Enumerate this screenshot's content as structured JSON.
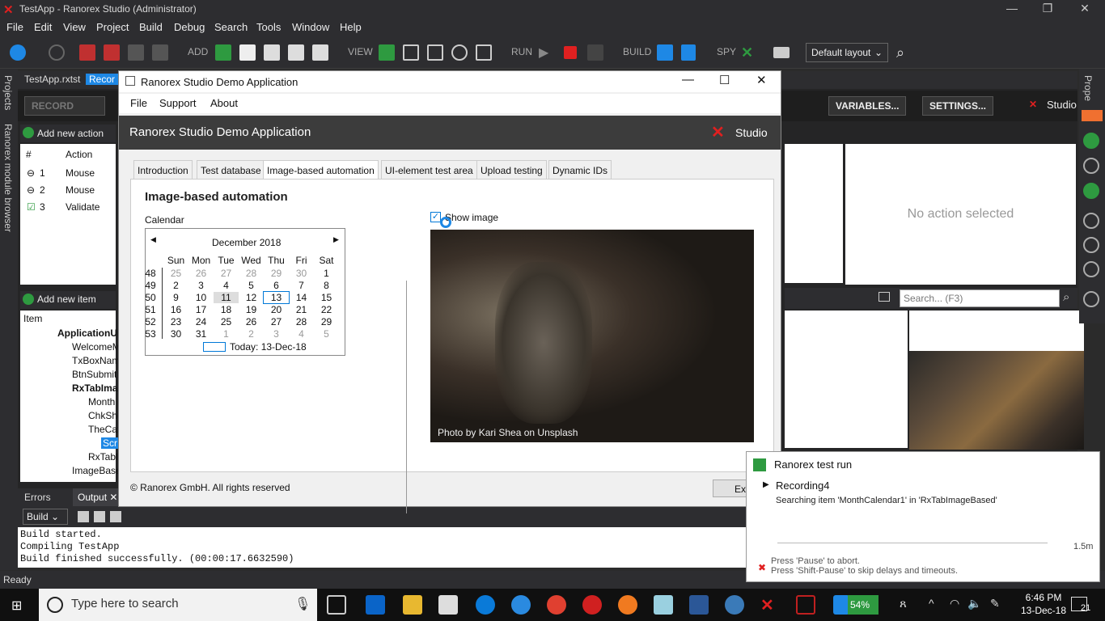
{
  "titlebar": {
    "title": "TestApp - Ranorex Studio (Administrator)"
  },
  "menu": [
    "File",
    "Edit",
    "View",
    "Project",
    "Build",
    "Debug",
    "Search",
    "Tools",
    "Window",
    "Help"
  ],
  "toolbar": {
    "add": "ADD",
    "view": "VIEW",
    "run": "RUN",
    "build": "BUILD",
    "spy": "SPY",
    "layout": "Default layout"
  },
  "left_strip": {
    "projects": "Projects",
    "module_browser": "Ranorex module browser"
  },
  "doc_tabs": {
    "file": "TestApp.rxtst",
    "rec": "Recor"
  },
  "recbar": {
    "record": "RECORD",
    "variables": "VARIABLES...",
    "settings": "SETTINGS...",
    "studio": "Studio"
  },
  "actions": {
    "add_label": "Add new action",
    "col_hash": "#",
    "col_action": "Action",
    "rows": [
      {
        "n": "1",
        "a": "Mouse"
      },
      {
        "n": "2",
        "a": "Mouse"
      },
      {
        "n": "3",
        "a": "Validate"
      }
    ]
  },
  "items": {
    "add_label": "Add new item",
    "header": "Item",
    "tree": [
      "ApplicationUn",
      "WelcomeM",
      "TxBoxNam",
      "BtnSubmit",
      "RxTabImag",
      "Month",
      "ChkSho",
      "TheCat",
      "Scr",
      "RxTabl",
      "ImageBase"
    ]
  },
  "right": {
    "no_action": "No action selected",
    "search_placeholder": "Search... (F3)"
  },
  "output": {
    "tab_errors": "Errors",
    "tab_output": "Output",
    "build_select": "Build",
    "lines": [
      "Build started.",
      "Compiling TestApp",
      "Build finished successfully. (00:00:17.6632590)"
    ]
  },
  "status": "Ready",
  "demo": {
    "title": "Ranorex Studio Demo Application",
    "menu": [
      "File",
      "Support",
      "About"
    ],
    "header": "Ranorex Studio Demo Application",
    "logo": "Studio",
    "tabs": [
      "Introduction",
      "Test database",
      "Image-based automation",
      "UI-element test area",
      "Upload testing",
      "Dynamic IDs"
    ],
    "section": "Image-based automation",
    "calendar_label": "Calendar",
    "show_image": "Show image",
    "month": "December 2018",
    "days": [
      "Sun",
      "Mon",
      "Tue",
      "Wed",
      "Thu",
      "Fri",
      "Sat"
    ],
    "weeks": [
      {
        "wk": "48",
        "d": [
          "25",
          "26",
          "27",
          "28",
          "29",
          "30",
          "1"
        ]
      },
      {
        "wk": "49",
        "d": [
          "2",
          "3",
          "4",
          "5",
          "6",
          "7",
          "8"
        ]
      },
      {
        "wk": "50",
        "d": [
          "9",
          "10",
          "11",
          "12",
          "13",
          "14",
          "15"
        ]
      },
      {
        "wk": "51",
        "d": [
          "16",
          "17",
          "18",
          "19",
          "20",
          "21",
          "22"
        ]
      },
      {
        "wk": "52",
        "d": [
          "23",
          "24",
          "25",
          "26",
          "27",
          "28",
          "29"
        ]
      },
      {
        "wk": "53",
        "d": [
          "30",
          "31",
          "1",
          "2",
          "3",
          "4",
          "5"
        ]
      }
    ],
    "today": "Today: 13-Dec-18",
    "photo_credit": "Photo by Kari Shea on Unsplash",
    "footer": "© Ranorex GmbH. All rights reserved",
    "exit": "Exit"
  },
  "toast": {
    "title": "Ranorex test run",
    "recording": "Recording4",
    "searching": "Searching item 'MonthCalendar1' in 'RxTabImageBased'",
    "time": "1.5m",
    "hint1": "Press 'Pause' to abort.",
    "hint2": "Press 'Shift-Pause' to skip delays and timeouts."
  },
  "taskbar": {
    "search": "Type here to search",
    "battery": "54%",
    "time": "6:46 PM",
    "date": "13-Dec-18",
    "notif": "21"
  }
}
